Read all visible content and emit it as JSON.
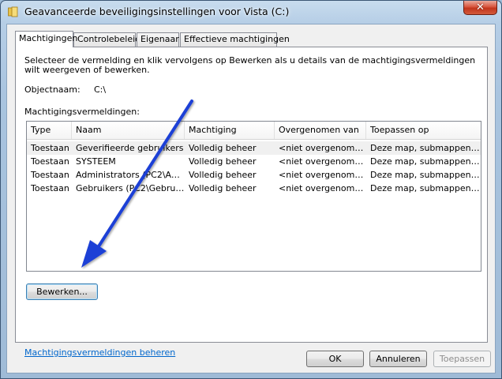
{
  "window": {
    "title": "Geavanceerde beveiligingsinstellingen voor Vista (C:)",
    "close_label": "✕"
  },
  "tabs": [
    {
      "label": "Machtigingen",
      "active": true
    },
    {
      "label": "Controlebeleid"
    },
    {
      "label": "Eigenaar"
    },
    {
      "label": "Effectieve machtigingen"
    }
  ],
  "main": {
    "description": "Selecteer de vermelding en klik vervolgens op Bewerken als u details van de machtigingsvermeldingen wilt weergeven of bewerken.",
    "object_label": "Objectnaam:",
    "object_value": "C:\\",
    "entries_label": "Machtigingsvermeldingen:",
    "columns": [
      "Type",
      "Naam",
      "Machtiging",
      "Overgenomen van",
      "Toepassen op"
    ],
    "rows": [
      [
        "Toestaan",
        "Geverifieerde gebruikers",
        "Volledig beheer",
        "<niet overgenomen>",
        "Deze map, submappen en..."
      ],
      [
        "Toestaan",
        "SYSTEEM",
        "Volledig beheer",
        "<niet overgenomen>",
        "Deze map, submappen en..."
      ],
      [
        "Toestaan",
        "Administrators (PC2\\Admi...",
        "Volledig beheer",
        "<niet overgenomen>",
        "Deze map, submappen en..."
      ],
      [
        "Toestaan",
        "Gebruikers (PC2\\Gebruik...",
        "Volledig beheer",
        "<niet overgenomen>",
        "Deze map, submappen en..."
      ]
    ],
    "edit_button": "Bewerken...",
    "manage_link": "Machtigingsvermeldingen beheren"
  },
  "footer": {
    "ok": "OK",
    "cancel": "Annuleren",
    "apply": "Toepassen"
  },
  "colors": {
    "annotation_arrow": "#1f3fd6",
    "link": "#0066cc"
  }
}
